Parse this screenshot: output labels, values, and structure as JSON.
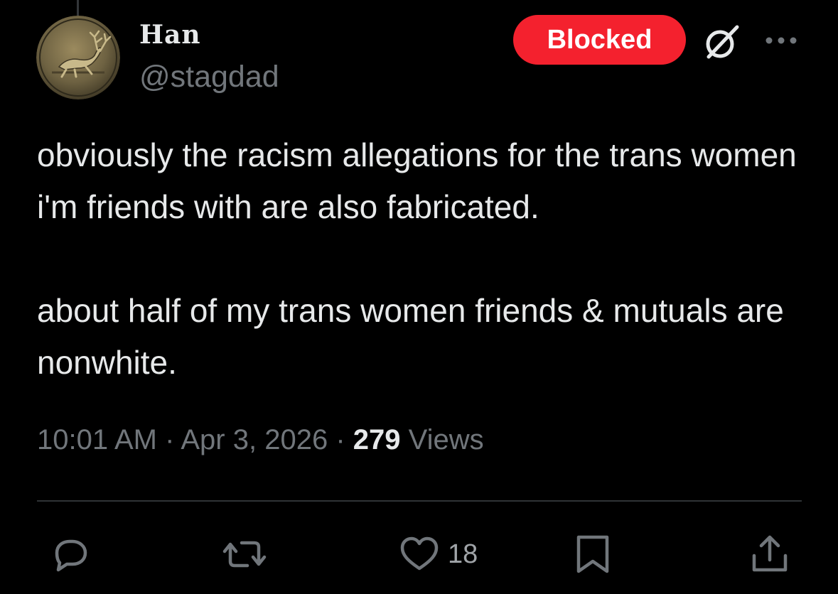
{
  "post": {
    "display_name": "Han",
    "handle": "@stagdad",
    "blocked_label": "Blocked",
    "text_paragraphs": [
      "obviously the racism allegations for the trans women i'm friends with are also fabricated.",
      "about half of my trans women friends & mutuals are nonwhite."
    ],
    "time": "10:01 AM",
    "date": "Apr 3, 2026",
    "separator": "·",
    "views_count": "279",
    "views_label": "Views"
  },
  "actions": {
    "like_count": "18"
  },
  "icons": {
    "avatar": "stag-medallion",
    "grok": "grok-icon",
    "more": "more-icon",
    "reply": "reply-icon",
    "repost": "repost-icon",
    "like": "heart-icon",
    "bookmark": "bookmark-icon",
    "share": "share-icon"
  },
  "colors": {
    "background": "#000000",
    "text": "#e7e9ea",
    "secondary_text": "#71767b",
    "blocked": "#f4212e",
    "divider": "#2f3336"
  }
}
